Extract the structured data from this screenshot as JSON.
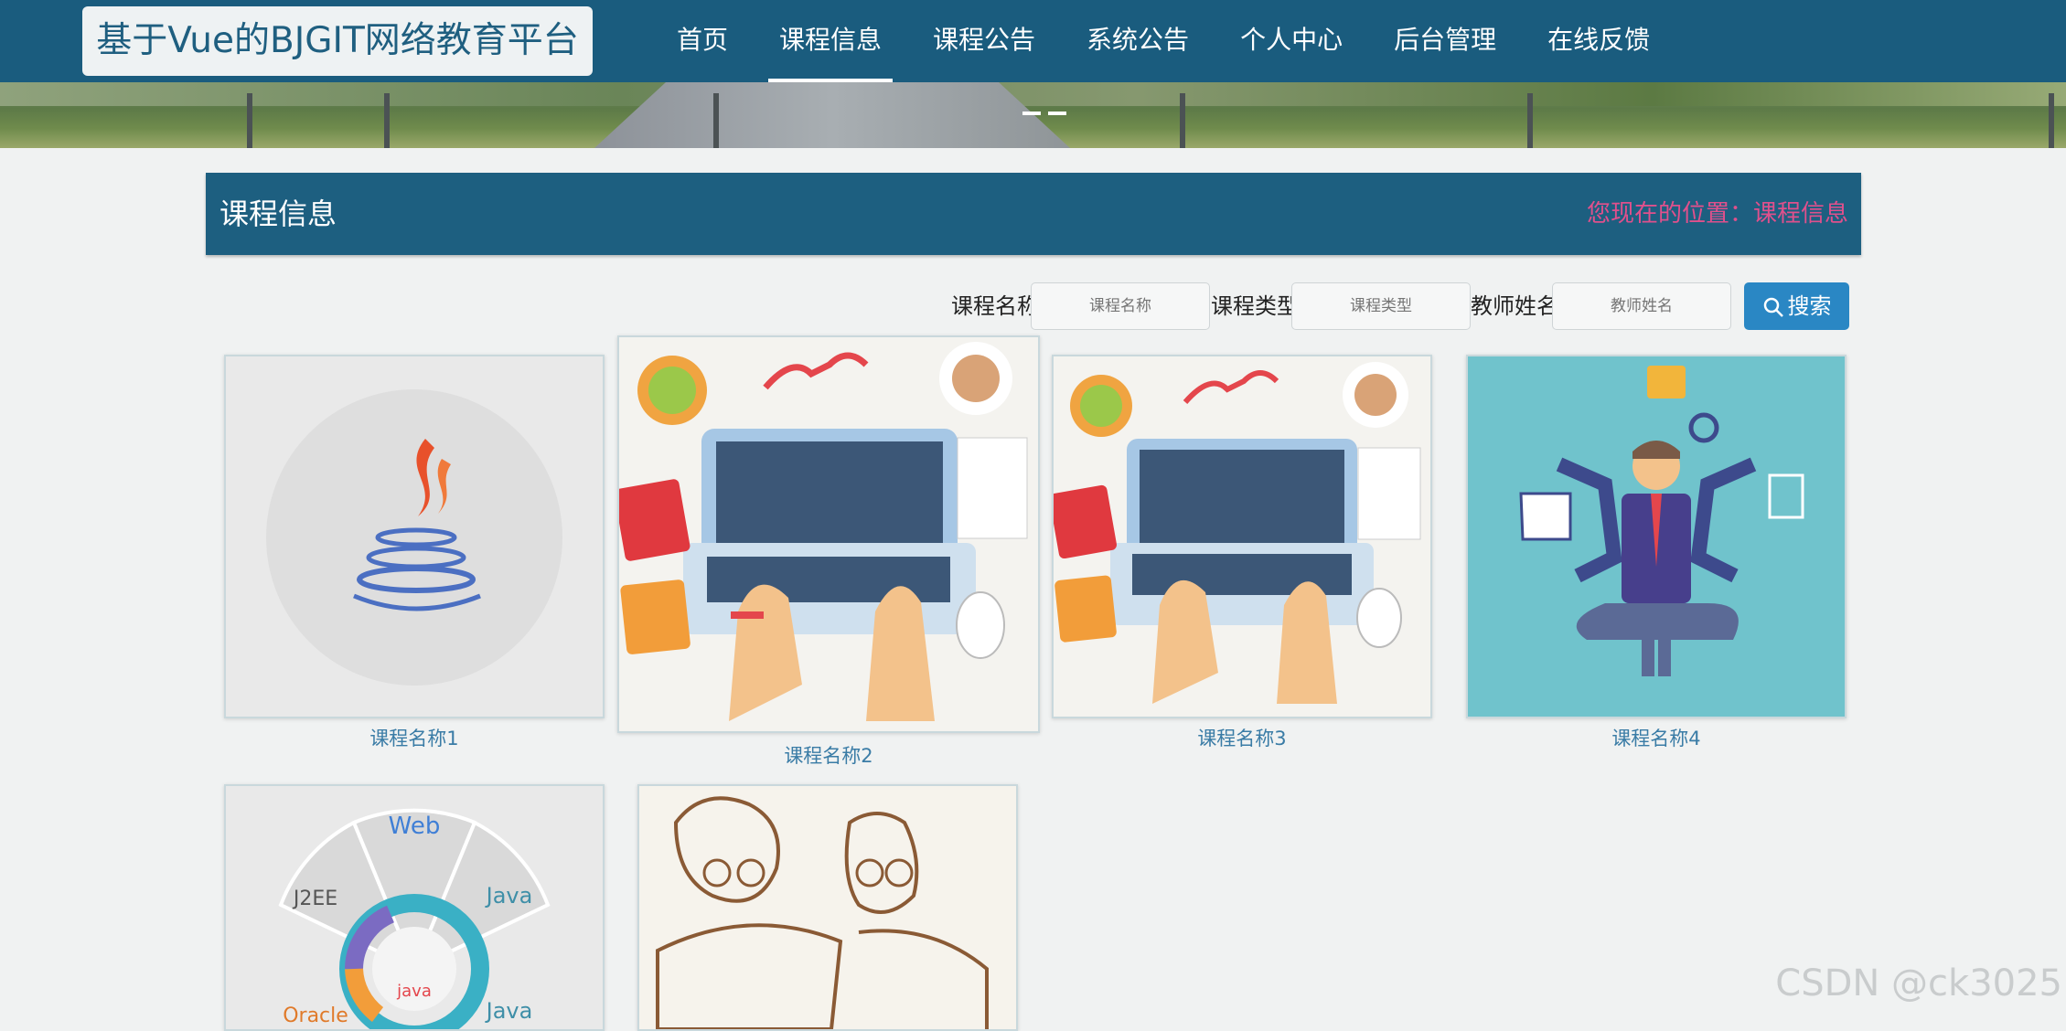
{
  "nav": {
    "logo": "基于Vue的BJGIT网络教育平台",
    "items": [
      {
        "label": "首页"
      },
      {
        "label": "课程信息"
      },
      {
        "label": "课程公告"
      },
      {
        "label": "系统公告"
      },
      {
        "label": "个人中心"
      },
      {
        "label": "后台管理"
      },
      {
        "label": "在线反馈"
      }
    ],
    "active_index": 1
  },
  "page": {
    "title": "课程信息",
    "breadcrumb": "您现在的位置：课程信息"
  },
  "search": {
    "course_name_label": "课程名称",
    "course_name_placeholder": "课程名称",
    "course_type_label": "课程类型",
    "course_type_placeholder": "课程类型",
    "teacher_label": "教师姓名",
    "teacher_placeholder": "教师姓名",
    "button": "搜索"
  },
  "courses": [
    {
      "name": "课程名称1",
      "image": "java-logo"
    },
    {
      "name": "课程名称2",
      "image": "laptop-coding-illustration"
    },
    {
      "name": "课程名称3",
      "image": "laptop-coding-illustration"
    },
    {
      "name": "课程名称4",
      "image": "multitasking-man-illustration"
    },
    {
      "name": "",
      "image": "java-tech-wheel",
      "wheel_labels": [
        "Web",
        "J2EE",
        "Java",
        "Oracle",
        "Java",
        "java"
      ]
    },
    {
      "name": "",
      "image": "sketch-people-illustration"
    }
  ],
  "watermark": "CSDN @ck3025",
  "colors": {
    "nav": "#1a5c7e",
    "title_bar": "#1d5f80",
    "breadcrumb": "#e0508c",
    "button": "#2a87c4",
    "course_name": "#3a7ca6"
  }
}
